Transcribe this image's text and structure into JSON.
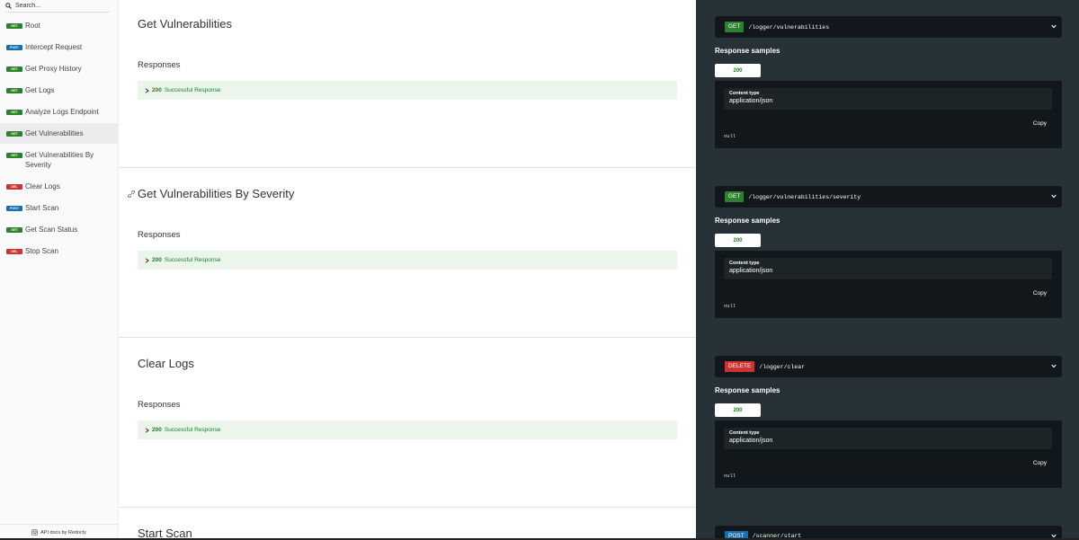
{
  "sidebar": {
    "search_placeholder": "Search...",
    "items": [
      {
        "method": "GET",
        "label": "Root"
      },
      {
        "method": "POST",
        "label": "Intercept Request"
      },
      {
        "method": "GET",
        "label": "Get Proxy History"
      },
      {
        "method": "GET",
        "label": "Get Logs"
      },
      {
        "method": "GET",
        "label": "Analyze Logs Endpoint"
      },
      {
        "method": "GET",
        "label": "Get Vulnerabilities",
        "active": true
      },
      {
        "method": "GET",
        "label": "Get Vulnerabilities By Severity"
      },
      {
        "method": "DEL",
        "label": "Clear Logs"
      },
      {
        "method": "POST",
        "label": "Start Scan"
      },
      {
        "method": "GET",
        "label": "Get Scan Status"
      },
      {
        "method": "DEL",
        "label": "Stop Scan"
      }
    ],
    "footer": "API docs by Redocly"
  },
  "operations": [
    {
      "title": "Get Vulnerabilities",
      "responses_heading": "Responses",
      "response_code": "200",
      "response_text": "Successful Response",
      "method": "GET",
      "path": "/logger/vulnerabilities",
      "samples_title": "Response samples",
      "tab": "200",
      "content_type_label": "Content type",
      "content_type": "application/json",
      "copy": "Copy",
      "sample_value": "null"
    },
    {
      "title": "Get Vulnerabilities By Severity",
      "responses_heading": "Responses",
      "response_code": "200",
      "response_text": "Successful Response",
      "method": "GET",
      "path": "/logger/vulnerabilities/severity",
      "samples_title": "Response samples",
      "tab": "200",
      "content_type_label": "Content type",
      "content_type": "application/json",
      "copy": "Copy",
      "sample_value": "null"
    },
    {
      "title": "Clear Logs",
      "responses_heading": "Responses",
      "response_code": "200",
      "response_text": "Successful Response",
      "method": "DELETE",
      "path": "/logger/clear",
      "samples_title": "Response samples",
      "tab": "200",
      "content_type_label": "Content type",
      "content_type": "application/json",
      "copy": "Copy",
      "sample_value": "null"
    },
    {
      "title": "Start Scan",
      "method": "POST",
      "path": "/scanner/start"
    }
  ],
  "colors": {
    "get": "#2f8132",
    "post": "#186faf",
    "delete": "#cc3333",
    "right_panel_bg": "#263238",
    "code_bg": "#11171a",
    "success_green": "#1d8127"
  }
}
